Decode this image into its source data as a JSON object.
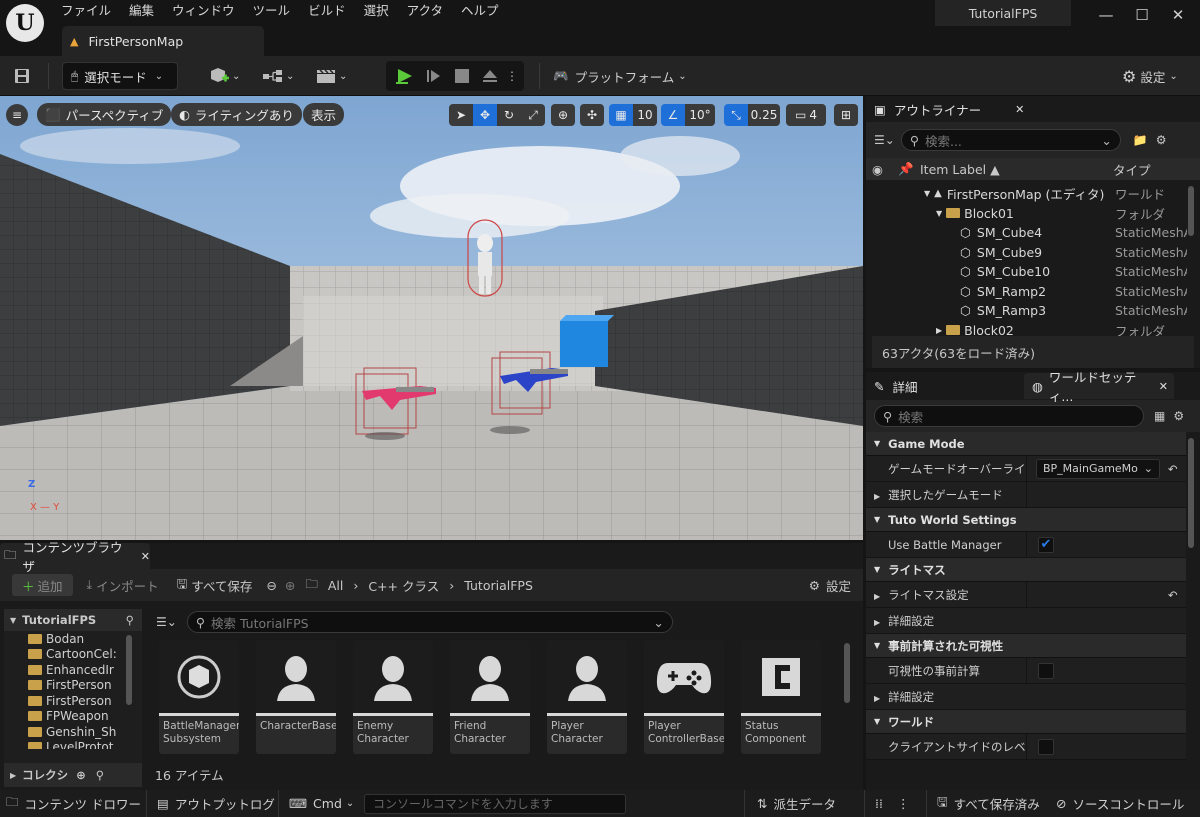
{
  "menu": [
    "ファイル",
    "編集",
    "ウィンドウ",
    "ツール",
    "ビルド",
    "選択",
    "アクタ",
    "ヘルプ"
  ],
  "project_title": "TutorialFPS",
  "doc_tab": "FirstPersonMap",
  "toolbar": {
    "select_mode": "選択モード",
    "platform": "プラットフォーム",
    "settings": "設定"
  },
  "viewport": {
    "menu_icon": "≡",
    "perspective": "パースペクティブ",
    "lighting": "ライティングあり",
    "show": "表示",
    "grid_snap": "10",
    "rot_snap": "10°",
    "scale_snap": "0.25",
    "camera_speed": "4",
    "axis_z": "Z",
    "axis_xy": "X — Y"
  },
  "outliner": {
    "tab": "アウトライナー",
    "search_placeholder": "検索...",
    "col_label": "Item Label ▲",
    "col_type": "タイプ",
    "rows": [
      {
        "label": "FirstPersonMap (エディタ)",
        "type": "ワールド"
      },
      {
        "label": "Block01",
        "type": "フォルダ"
      },
      {
        "label": "SM_Cube4",
        "type": "StaticMeshA"
      },
      {
        "label": "SM_Cube9",
        "type": "StaticMeshA"
      },
      {
        "label": "SM_Cube10",
        "type": "StaticMeshA"
      },
      {
        "label": "SM_Ramp2",
        "type": "StaticMeshA"
      },
      {
        "label": "SM_Ramp3",
        "type": "StaticMeshA"
      },
      {
        "label": "Block02",
        "type": "フォルダ"
      }
    ],
    "status": "63アクタ(63をロード済み)"
  },
  "details": {
    "tab_details": "詳細",
    "tab_world": "ワールドセッティ...",
    "search_placeholder": "検索",
    "sections": {
      "game_mode": "Game Mode",
      "gm_override": "ゲームモードオーバーライド",
      "gm_override_value": "BP_MainGameMo",
      "selected_gm": "選択したゲームモード",
      "tuto": "Tuto World Settings",
      "use_battle": "Use Battle Manager",
      "lightmass": "ライトマス",
      "lightmass_settings": "ライトマス設定",
      "advanced1": "詳細設定",
      "precomputed": "事前計算された可視性",
      "precompute_vis": "可視性の事前計算",
      "advanced2": "詳細設定",
      "world": "ワールド",
      "client_level": "クライアントサイドのレベル..."
    }
  },
  "content_browser": {
    "tab": "コンテンツブラウザ",
    "add": "追加",
    "import": "インポート",
    "save_all": "すべて保存",
    "path": [
      "All",
      "C++ クラス",
      "TutorialFPS"
    ],
    "settings": "設定",
    "root": "TutorialFPS",
    "folders": [
      "Bodan",
      "CartoonCel:",
      "EnhancedIr",
      "FirstPerson",
      "FirstPerson",
      "FPWeapon",
      "Genshin_Sh",
      "LevelProtot"
    ],
    "collections": "コレクシ",
    "search_placeholder": "検索 TutorialFPS",
    "assets": [
      {
        "name": "BattleManager Subsystem",
        "icon": "subsystem-icon"
      },
      {
        "name": "CharacterBase",
        "icon": "character-icon"
      },
      {
        "name": "Enemy Character",
        "icon": "character-icon"
      },
      {
        "name": "Friend Character",
        "icon": "character-icon"
      },
      {
        "name": "Player Character",
        "icon": "character-icon"
      },
      {
        "name": "Player ControllerBase",
        "icon": "gamepad-icon"
      },
      {
        "name": "Status Component",
        "icon": "component-icon"
      }
    ],
    "count": "16 アイテム"
  },
  "statusbar": {
    "drawer": "コンテンツ ドロワー",
    "output": "アウトプットログ",
    "cmd": "Cmd",
    "console_placeholder": "コンソールコマンドを入力します",
    "derived": "派生データ",
    "saved": "すべて保存済み",
    "source": "ソースコントロール"
  }
}
